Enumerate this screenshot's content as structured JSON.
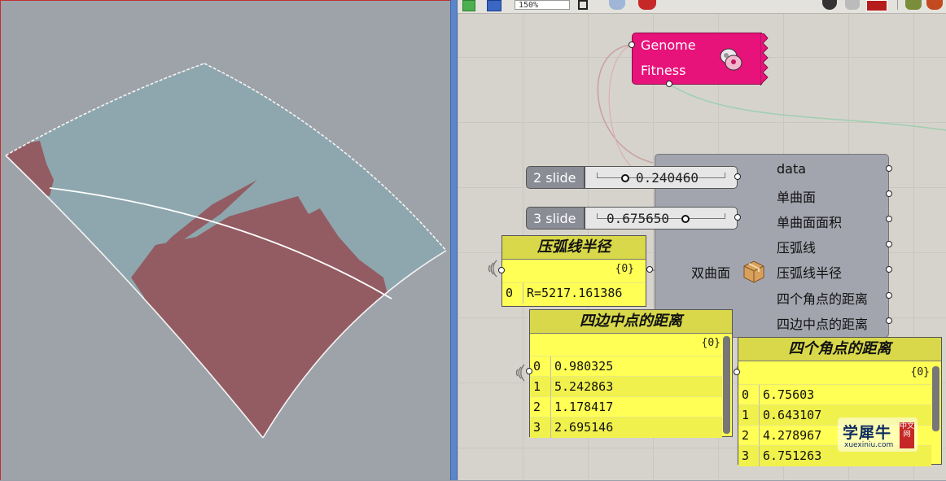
{
  "toolbar": {
    "zoom_value": "150%",
    "icons": [
      "preview-green-icon",
      "save-icon",
      "zoom-fit-icon",
      "eye-icon",
      "pen-icon",
      "hat-icon",
      "eraser-icon",
      "bake-icon",
      "plugin-icon-1",
      "plugin-icon-2"
    ]
  },
  "galapagos": {
    "genome_label": "Genome",
    "fitness_label": "Fitness",
    "icon": "galapagos-icon",
    "color": "#e8127b"
  },
  "sliders": [
    {
      "name": "2 slide",
      "value": "0.240460",
      "position": 0.24046
    },
    {
      "name": "3 slide",
      "value": "0.675650",
      "position": 0.67565
    }
  ],
  "cluster": {
    "input_label": "双曲面",
    "icon": "cluster-box-icon",
    "outputs": [
      "data",
      "单曲面",
      "单曲面面积",
      "压弧线",
      "压弧线半径",
      "四个角点的距离",
      "四边中点的距离"
    ]
  },
  "panels": {
    "arc_radius": {
      "title": "压弧线半径",
      "path": "{0}",
      "rows": [
        {
          "index": "0",
          "value": "R=5217.161386"
        }
      ]
    },
    "edge_midpoints": {
      "title": "四边中点的距离",
      "path": "{0}",
      "rows": [
        {
          "index": "0",
          "value": "0.980325"
        },
        {
          "index": "1",
          "value": "5.242863"
        },
        {
          "index": "2",
          "value": "1.178417"
        },
        {
          "index": "3",
          "value": "2.695146"
        }
      ]
    },
    "corner_points": {
      "title": "四个角点的距离",
      "path": "{0}",
      "rows": [
        {
          "index": "0",
          "value": "6.75603"
        },
        {
          "index": "1",
          "value": "0.643107"
        },
        {
          "index": "2",
          "value": "4.278967"
        },
        {
          "index": "3",
          "value": "6.751263"
        }
      ]
    }
  },
  "watermark": {
    "main": "学犀牛",
    "sub": "xuexiniu.com",
    "seal": "中文网"
  },
  "colors": {
    "surface_blue": "#8aa6ae",
    "surface_red": "#935c63",
    "panel_yellow": "#ffff55",
    "cluster_grey": "#a3a5ae"
  }
}
